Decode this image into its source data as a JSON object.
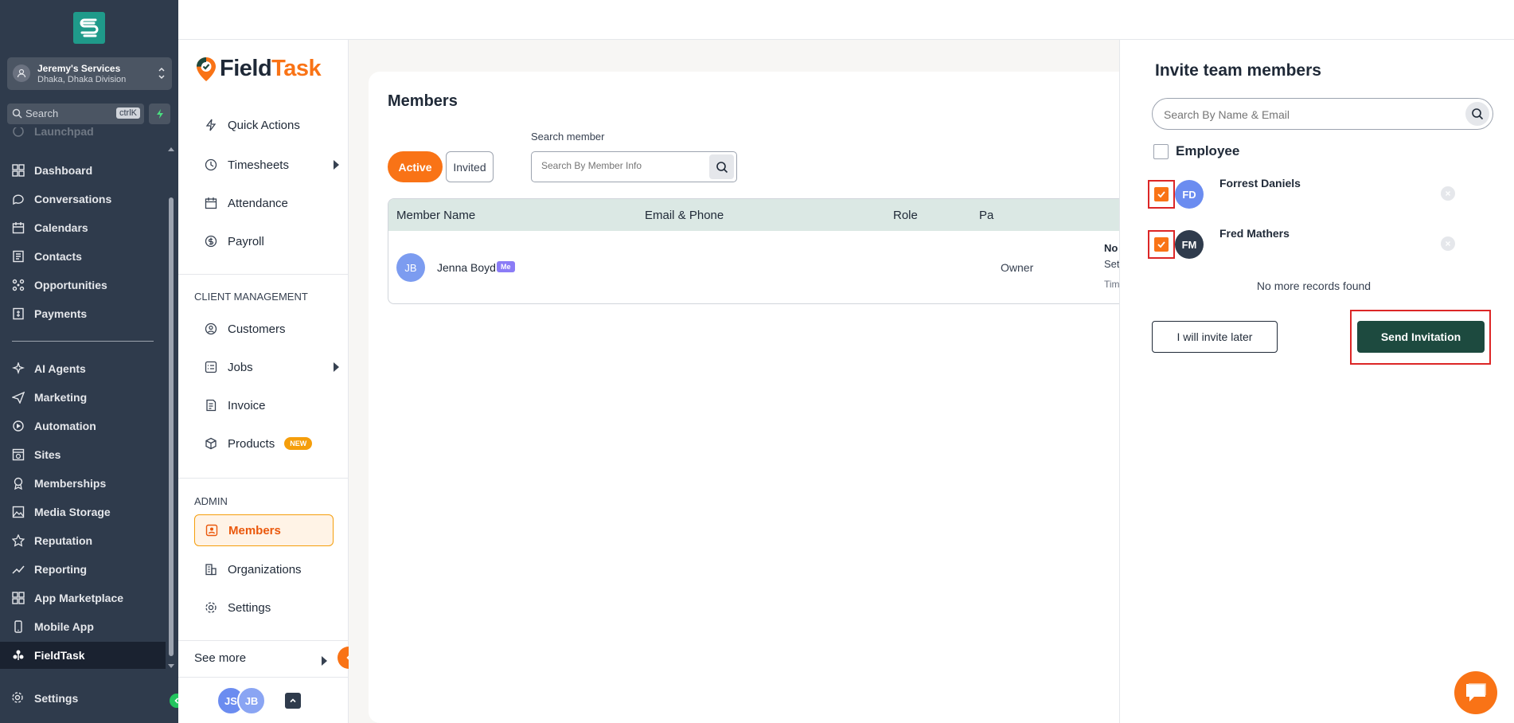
{
  "sidebar": {
    "account_name": "Jeremy's Services",
    "account_location": "Dhaka, Dhaka Division",
    "search_placeholder": "Search",
    "search_shortcut": "ctrlK",
    "items": [
      {
        "label": "Launchpad",
        "icon": "launchpad-icon"
      },
      {
        "label": "Dashboard",
        "icon": "dashboard-icon"
      },
      {
        "label": "Conversations",
        "icon": "chat-icon"
      },
      {
        "label": "Calendars",
        "icon": "calendar-icon"
      },
      {
        "label": "Contacts",
        "icon": "contacts-icon"
      },
      {
        "label": "Opportunities",
        "icon": "opportunities-icon"
      },
      {
        "label": "Payments",
        "icon": "payments-icon"
      },
      {
        "label": "AI Agents",
        "icon": "ai-agents-icon"
      },
      {
        "label": "Marketing",
        "icon": "marketing-icon"
      },
      {
        "label": "Automation",
        "icon": "automation-icon"
      },
      {
        "label": "Sites",
        "icon": "sites-icon"
      },
      {
        "label": "Memberships",
        "icon": "memberships-icon"
      },
      {
        "label": "Media Storage",
        "icon": "media-icon"
      },
      {
        "label": "Reputation",
        "icon": "star-icon"
      },
      {
        "label": "Reporting",
        "icon": "reporting-icon"
      },
      {
        "label": "App Marketplace",
        "icon": "marketplace-icon"
      },
      {
        "label": "Mobile App",
        "icon": "mobile-icon"
      },
      {
        "label": "FieldTask",
        "icon": "fieldtask-icon"
      }
    ],
    "settings_label": "Settings"
  },
  "fieldtask_nav": {
    "logo_part1": "Field",
    "logo_part2": "Task",
    "quick_actions": "Quick Actions",
    "timesheets": "Timesheets",
    "attendance": "Attendance",
    "payroll": "Payroll",
    "client_section": "CLIENT MANAGEMENT",
    "customers": "Customers",
    "jobs": "Jobs",
    "invoice": "Invoice",
    "products": "Products",
    "products_badge": "NEW",
    "admin_section": "ADMIN",
    "members": "Members",
    "organizations": "Organizations",
    "settings": "Settings",
    "see_more": "See more",
    "user_initials_1": "JS",
    "user_initials_2": "JB"
  },
  "main": {
    "title": "Members",
    "tab_active": "Active",
    "tab_invited": "Invited",
    "search_label": "Search member",
    "search_placeholder": "Search By Member Info",
    "columns": [
      "Member Name",
      "Email & Phone",
      "Role",
      "Pa"
    ],
    "rows": [
      {
        "initials": "JB",
        "name": "Jenna Boyd",
        "badge": "Me",
        "role": "Owner",
        "pay1": "No",
        "pay2": "Set",
        "pay3": "Tim"
      }
    ]
  },
  "invite": {
    "title": "Invite team members",
    "search_placeholder": "Search By Name & Email",
    "employee_label": "Employee",
    "members": [
      {
        "initials": "FD",
        "name": "Forrest Daniels",
        "checked": true,
        "avatar_color": "#6b8cf0"
      },
      {
        "initials": "FM",
        "name": "Fred Mathers",
        "checked": true,
        "avatar_color": "#2f3b4c"
      }
    ],
    "no_more": "No more records found",
    "later_button": "I will invite later",
    "send_button": "Send Invitation"
  },
  "colors": {
    "accent": "#f97316",
    "sidebar": "#2f3b4c",
    "send_button": "#1d4a3f",
    "highlight": "#dc2626"
  }
}
